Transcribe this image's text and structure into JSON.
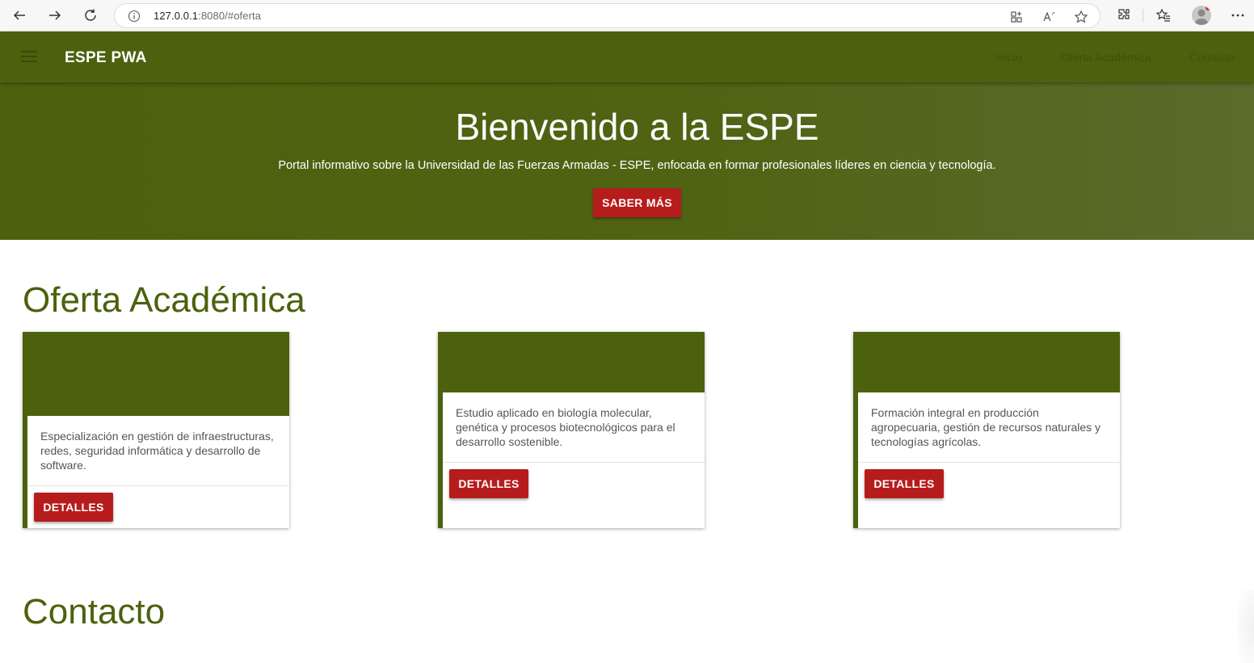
{
  "browser": {
    "url_host": "127.0.0.1",
    "url_rest": ":8080/#oferta"
  },
  "appbar": {
    "brand": "ESPE PWA",
    "nav": [
      "Inicio",
      "Oferta Académica",
      "Contacto"
    ]
  },
  "hero": {
    "title": "Bienvenido a la ESPE",
    "subtitle": "Portal informativo sobre la Universidad de las Fuerzas Armadas - ESPE, enfocada en formar profesionales líderes en ciencia y tecnología.",
    "button": "SABER MÁS"
  },
  "oferta": {
    "title": "Oferta Académica",
    "cards": [
      {
        "text": "Especialización en gestión de infraestructuras, redes, seguridad informática y desarrollo de software.",
        "button": "DETALLES"
      },
      {
        "text": "Estudio aplicado en biología molecular, genética y procesos biotecnológicos para el desarrollo sostenible.",
        "button": "DETALLES"
      },
      {
        "text": "Formación integral en producción agropecuaria, gestión de recursos naturales y tecnologías agrícolas.",
        "button": "DETALLES"
      }
    ]
  },
  "contacto": {
    "title": "Contacto"
  },
  "colors": {
    "primary": "#4c610d",
    "accent": "#b71c1c"
  }
}
